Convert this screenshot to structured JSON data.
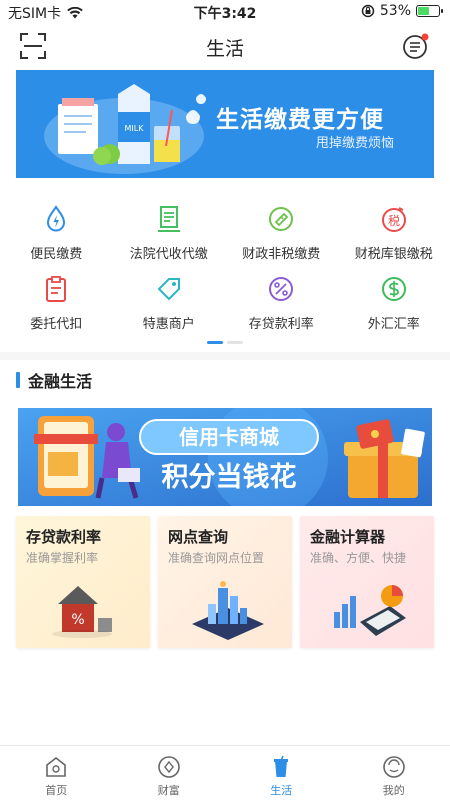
{
  "status_bar": {
    "carrier": "无SIM卡",
    "time": "下午3:42",
    "battery": "53%",
    "battery_level": 0.53
  },
  "nav": {
    "title": "生活"
  },
  "banner": {
    "main_text": "生活缴费更方便",
    "sub_text": "甩掉缴费烦恼",
    "milk_label": "MILK"
  },
  "services": [
    {
      "label": "便民缴费",
      "icon": "water-drop-icon"
    },
    {
      "label": "法院代收代缴",
      "icon": "document-icon"
    },
    {
      "label": "财政非税缴费",
      "icon": "ticket-icon"
    },
    {
      "label": "财税库银缴税",
      "icon": "tax-icon"
    },
    {
      "label": "委托代扣",
      "icon": "clipboard-icon"
    },
    {
      "label": "特惠商户",
      "icon": "tag-icon"
    },
    {
      "label": "存贷款利率",
      "icon": "percent-icon"
    },
    {
      "label": "外汇汇率",
      "icon": "dollar-icon"
    }
  ],
  "tax_glyph": "税",
  "section_title": "金融生活",
  "promo": {
    "line1": "信用卡商城",
    "line2": "积分当钱花"
  },
  "cards": [
    {
      "title": "存贷款利率",
      "subtitle": "准确掌握利率"
    },
    {
      "title": "网点查询",
      "subtitle": "准确查询网点位置"
    },
    {
      "title": "金融计算器",
      "subtitle": "准确、方便、快捷"
    }
  ],
  "tabs": [
    {
      "label": "首页",
      "active": false
    },
    {
      "label": "财富",
      "active": false
    },
    {
      "label": "生活",
      "active": true
    },
    {
      "label": "我的",
      "active": false
    }
  ],
  "colors": {
    "accent": "#2d8ee8",
    "badge": "#f44336",
    "banner_bg": "#2d8ee8"
  }
}
